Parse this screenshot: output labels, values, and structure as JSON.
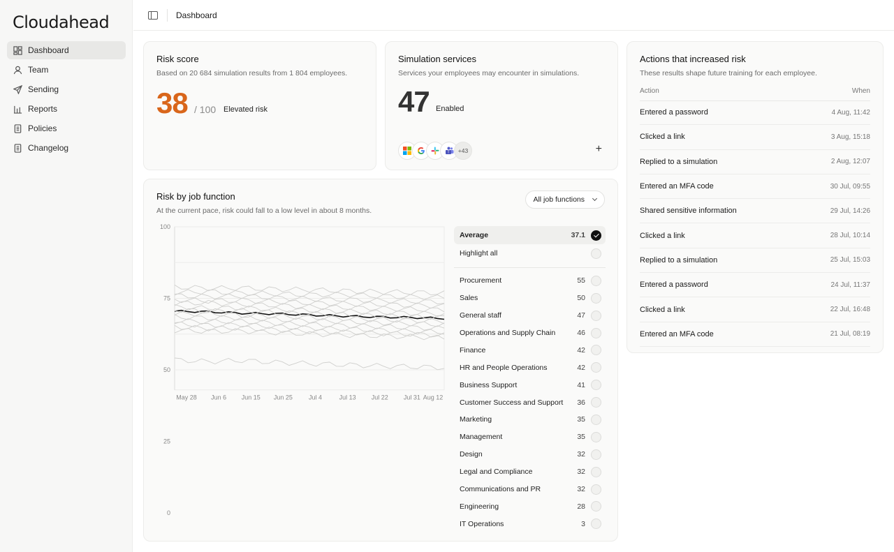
{
  "brand": "Cloudahead",
  "nav": [
    {
      "label": "Dashboard",
      "icon": "grid-icon",
      "active": true
    },
    {
      "label": "Team",
      "icon": "user-icon",
      "active": false
    },
    {
      "label": "Sending",
      "icon": "send-icon",
      "active": false
    },
    {
      "label": "Reports",
      "icon": "bar-chart-icon",
      "active": false
    },
    {
      "label": "Policies",
      "icon": "document-icon",
      "active": false
    },
    {
      "label": "Changelog",
      "icon": "document-icon",
      "active": false
    }
  ],
  "header": {
    "title": "Dashboard"
  },
  "risk": {
    "title": "Risk score",
    "subtitle": "Based on 20 684 simulation results from 1 804 employees.",
    "score": "38",
    "denominator": "/ 100",
    "level": "Elevated risk"
  },
  "simulation": {
    "title": "Simulation services",
    "subtitle": "Services your employees may encounter in simulations.",
    "count": "47",
    "status": "Enabled",
    "services": [
      "microsoft-icon",
      "google-icon",
      "slack-icon",
      "teams-icon"
    ],
    "more": "+43",
    "add": "+"
  },
  "actions": {
    "title": "Actions that increased risk",
    "subtitle": "These results shape future training for each employee.",
    "col_action": "Action",
    "col_when": "When",
    "rows": [
      {
        "action": "Entered a password",
        "when": "4 Aug, 11:42"
      },
      {
        "action": "Clicked a link",
        "when": "3 Aug, 15:18"
      },
      {
        "action": "Replied to a simulation",
        "when": "2 Aug, 12:07"
      },
      {
        "action": "Entered an MFA code",
        "when": "30 Jul, 09:55"
      },
      {
        "action": "Shared sensitive information",
        "when": "29 Jul, 14:26"
      },
      {
        "action": "Clicked a link",
        "when": "28 Jul, 10:14"
      },
      {
        "action": "Replied to a simulation",
        "when": "25 Jul, 15:03"
      },
      {
        "action": "Entered a password",
        "when": "24 Jul, 11:37"
      },
      {
        "action": "Clicked a link",
        "when": "22 Jul, 16:48"
      },
      {
        "action": "Entered an MFA code",
        "when": "21 Jul, 08:19"
      }
    ]
  },
  "jobs": {
    "title": "Risk by job function",
    "subtitle": "At the current pace, risk could fall to a low level in about 8 months.",
    "filter": "All job functions",
    "average_label": "Average",
    "average_value": "37.1",
    "highlight_label": "Highlight all",
    "functions": [
      {
        "name": "Procurement",
        "value": "55"
      },
      {
        "name": "Sales",
        "value": "50"
      },
      {
        "name": "General staff",
        "value": "47"
      },
      {
        "name": "Operations and Supply Chain",
        "value": "46"
      },
      {
        "name": "Finance",
        "value": "42"
      },
      {
        "name": "HR and People Operations",
        "value": "42"
      },
      {
        "name": "Business Support",
        "value": "41"
      },
      {
        "name": "Customer Success and Support",
        "value": "36"
      },
      {
        "name": "Marketing",
        "value": "35"
      },
      {
        "name": "Management",
        "value": "35"
      },
      {
        "name": "Design",
        "value": "32"
      },
      {
        "name": "Legal and Compliance",
        "value": "32"
      },
      {
        "name": "Communications and PR",
        "value": "32"
      },
      {
        "name": "Engineering",
        "value": "28"
      },
      {
        "name": "IT Operations",
        "value": "3"
      }
    ]
  },
  "chart_data": {
    "type": "line",
    "x": [
      "May 28",
      "Jun 6",
      "Jun 15",
      "Jun 25",
      "Jul 4",
      "Jul 13",
      "Jul 22",
      "Jul 31",
      "Aug 12"
    ],
    "y_ticks": [
      100,
      75,
      50,
      25,
      0
    ],
    "ylim": [
      0,
      100
    ],
    "grid": true,
    "series": [
      {
        "emphasis": true,
        "values": [
          70.5,
          70.3,
          69.8,
          69.6,
          69.2,
          68.8,
          68.5,
          68.3,
          68.0
        ]
      },
      {
        "values": [
          79,
          78.5,
          78.6,
          78.2,
          78.0,
          77.6,
          77.3,
          77.1,
          76.8
        ]
      },
      {
        "values": [
          77,
          77.4,
          76.8,
          76.6,
          76.2,
          76.4,
          75.8,
          75.5,
          75.3
        ]
      },
      {
        "values": [
          76,
          75.6,
          75.8,
          75.2,
          74.8,
          74.6,
          74.2,
          74.0,
          73.7
        ]
      },
      {
        "values": [
          74.5,
          74.1,
          74.3,
          73.8,
          73.4,
          73.1,
          72.9,
          72.6,
          72.3
        ]
      },
      {
        "values": [
          73.2,
          73.5,
          72.8,
          72.6,
          72.0,
          71.8,
          71.5,
          71.2,
          71.0
        ]
      },
      {
        "values": [
          72.0,
          71.5,
          71.7,
          71.0,
          70.8,
          70.5,
          70.1,
          69.8,
          69.5
        ]
      },
      {
        "values": [
          71.0,
          70.5,
          70.7,
          70.1,
          69.6,
          69.3,
          69.0,
          68.6,
          68.3
        ]
      },
      {
        "values": [
          69.5,
          69.8,
          69.0,
          68.8,
          68.3,
          68.0,
          67.6,
          67.3,
          67.0
        ]
      },
      {
        "values": [
          68.5,
          68.1,
          68.3,
          67.6,
          67.2,
          66.9,
          66.5,
          66.2,
          65.8
        ]
      },
      {
        "values": [
          67.2,
          66.8,
          67.0,
          66.3,
          65.9,
          65.5,
          65.2,
          64.8,
          64.5
        ]
      },
      {
        "values": [
          66.0,
          65.6,
          65.8,
          65.1,
          64.6,
          64.3,
          63.9,
          63.5,
          63.2
        ]
      },
      {
        "values": [
          65.0,
          64.5,
          64.7,
          64.0,
          63.5,
          63.2,
          62.8,
          62.5,
          62.1
        ]
      },
      {
        "values": [
          63.8,
          63.5,
          63.6,
          63.0,
          62.6,
          62.2,
          61.9,
          61.6,
          61.2
        ]
      },
      {
        "values": [
          53.5,
          52.9,
          53.3,
          52.6,
          52.2,
          51.8,
          51.4,
          51.1,
          50.8
        ]
      }
    ]
  }
}
